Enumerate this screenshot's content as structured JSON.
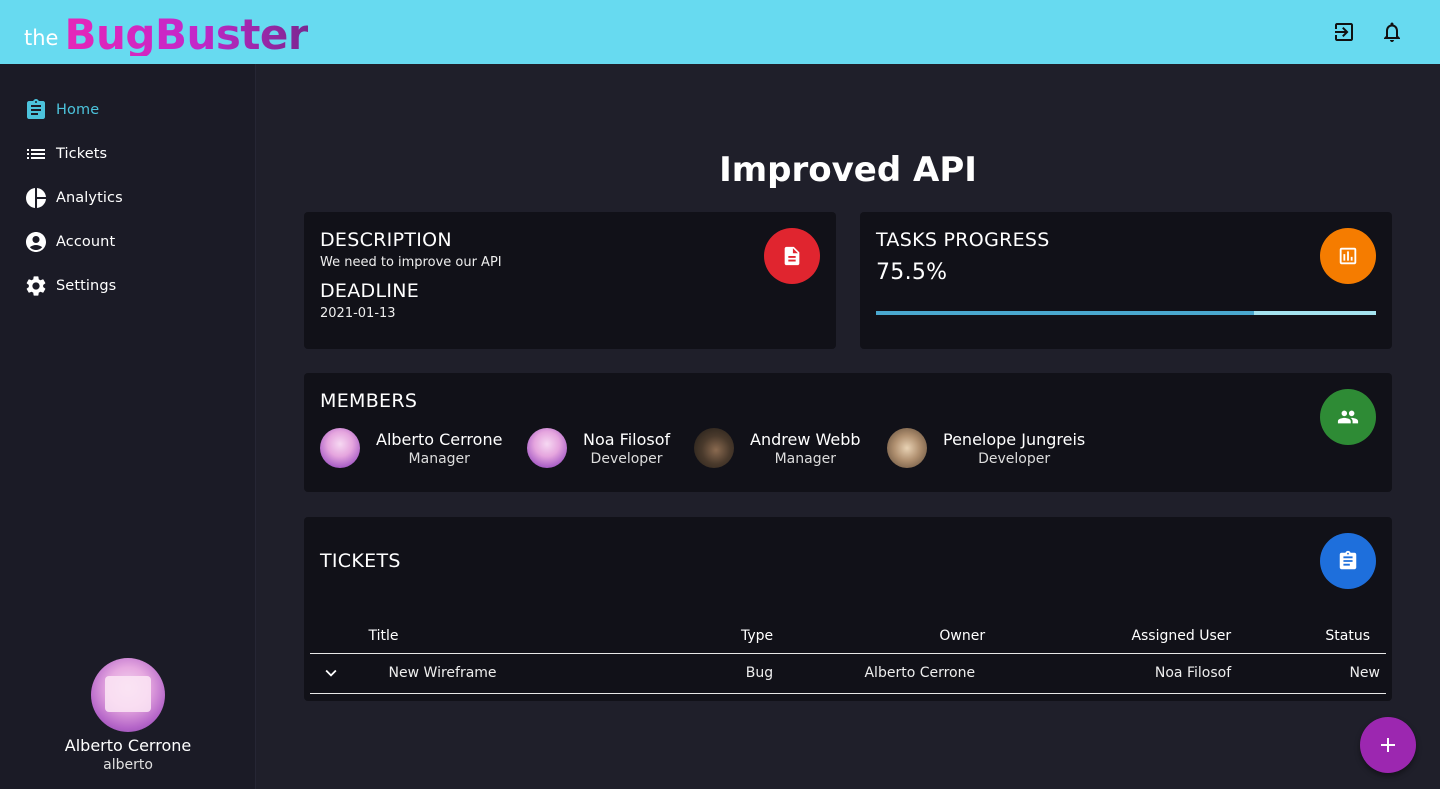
{
  "app": {
    "logo_prefix": "the",
    "logo_name": "BugBuster"
  },
  "topbar": {
    "icons": [
      "exit-to-app-icon",
      "bell-icon"
    ]
  },
  "sidebar": {
    "items": [
      {
        "label": "Home",
        "icon": "clipboard-icon",
        "active": true
      },
      {
        "label": "Tickets",
        "icon": "list-icon",
        "active": false
      },
      {
        "label": "Analytics",
        "icon": "pie-chart-icon",
        "active": false
      },
      {
        "label": "Account",
        "icon": "account-circle-icon",
        "active": false
      },
      {
        "label": "Settings",
        "icon": "gear-icon",
        "active": false
      }
    ],
    "profile": {
      "name": "Alberto Cerrone",
      "username": "alberto"
    }
  },
  "page": {
    "title": "Improved API"
  },
  "description_card": {
    "title": "DESCRIPTION",
    "text": "We need to improve our API",
    "deadline_title": "DEADLINE",
    "deadline": "2021-01-13",
    "icon": "document-icon",
    "icon_color": "#e0252f"
  },
  "progress_card": {
    "title": "TASKS PROGRESS",
    "value_text": "75.5%",
    "progress": 75.5,
    "icon": "bar-chart-icon",
    "icon_color": "#f57c00"
  },
  "members_card": {
    "title": "MEMBERS",
    "icon": "group-icon",
    "icon_color": "#2e8b35",
    "members": [
      {
        "name": "Alberto Cerrone",
        "role": "Manager"
      },
      {
        "name": "Noa Filosof",
        "role": "Developer"
      },
      {
        "name": "Andrew Webb",
        "role": "Manager"
      },
      {
        "name": "Penelope Jungreis",
        "role": "Developer"
      }
    ]
  },
  "tickets_card": {
    "title": "TICKETS",
    "icon": "clipboard-icon",
    "icon_color": "#1e6fdc",
    "columns": [
      "Title",
      "Type",
      "Owner",
      "Assigned User",
      "Status"
    ],
    "rows": [
      {
        "title": "New Wireframe",
        "type": "Bug",
        "owner": "Alberto Cerrone",
        "assigned": "Noa Filosof",
        "status": "New"
      }
    ]
  },
  "fab": {
    "icon": "plus-icon",
    "color": "#9c27b0"
  },
  "colors": {
    "topbar": "#67daf0",
    "accent": "#4cc3dc",
    "background": "#1f1f2a",
    "card": "#111118"
  }
}
